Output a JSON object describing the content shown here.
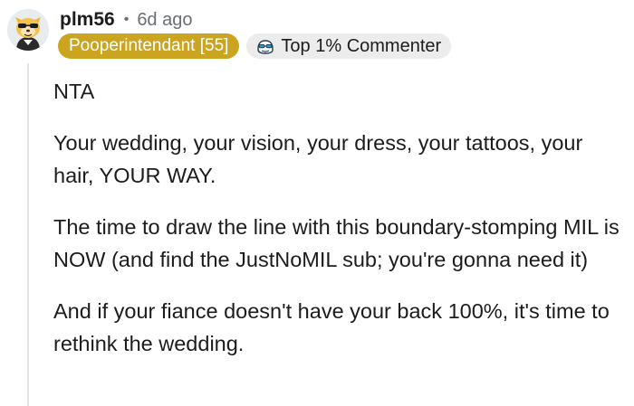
{
  "comment": {
    "username": "plm56",
    "separator": "•",
    "timestamp": "6d ago",
    "flair": "Pooperintendant [55]",
    "top_commenter_label": "Top 1% Commenter",
    "icons": {
      "avatar": "snoo-avatar-icon",
      "top_commenter": "commenter-badge-icon"
    },
    "colors": {
      "flair_bg": "#cba51f",
      "badge_bg": "#ececec",
      "meta_text": "#6a6f73",
      "thread_line": "#e2e4e6"
    },
    "paragraphs": [
      "NTA",
      "Your wedding, your vision, your dress, your tattoos, your hair, YOUR WAY.",
      "The time to draw the line with this boundary-stomping MIL is NOW (and find the JustNoMIL sub; you're gonna need it)",
      "And if your fiance doesn't have your back 100%, it's time to rethink the wedding."
    ]
  }
}
